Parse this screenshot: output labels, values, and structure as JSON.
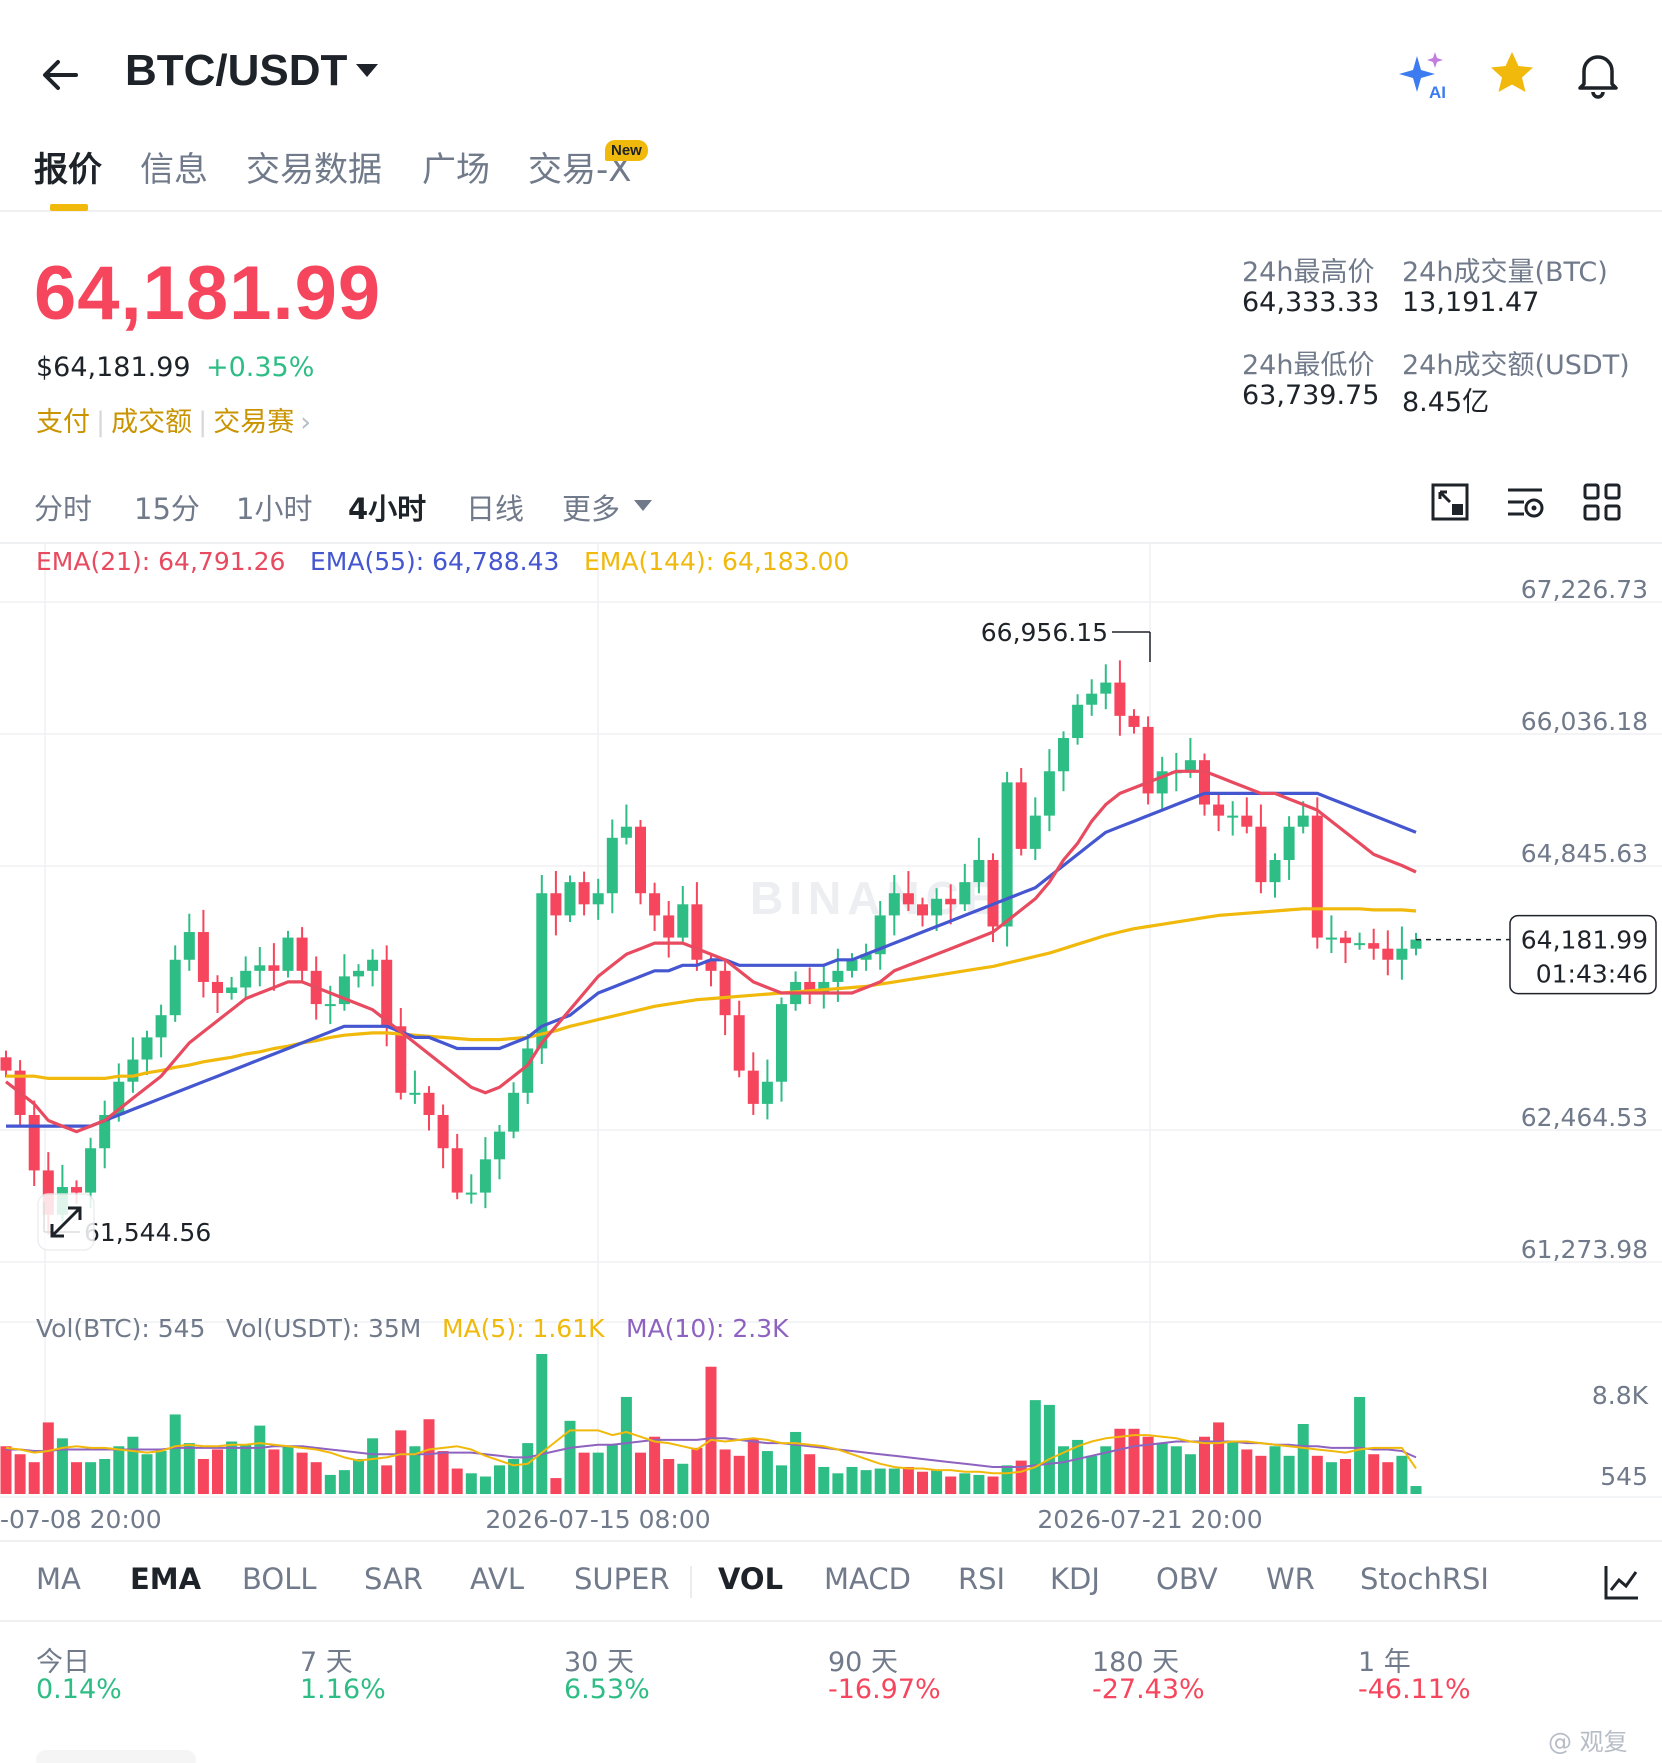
{
  "header": {
    "pair": "BTC/USDT",
    "icons": [
      "back-arrow-icon",
      "ai-sparkle-icon",
      "star-icon",
      "bell-icon"
    ],
    "ai_label": "AI"
  },
  "tabs": [
    {
      "label": "报价",
      "active": true
    },
    {
      "label": "信息",
      "active": false
    },
    {
      "label": "交易数据",
      "active": false
    },
    {
      "label": "广场",
      "active": false
    },
    {
      "label": "交易-X",
      "active": false
    }
  ],
  "new_badge": "New",
  "price": {
    "last": "64,181.99",
    "usd": "$64,181.99",
    "change": "+0.35%"
  },
  "links": [
    "支付",
    "成交额",
    "交易赛"
  ],
  "stats": {
    "high_label": "24h最高价",
    "high": "64,333.33",
    "low_label": "24h最低价",
    "low": "63,739.75",
    "vol_btc_label": "24h成交量(BTC)",
    "vol_btc": "13,191.47",
    "vol_usdt_label": "24h成交额(USDT)",
    "vol_usdt": "8.45亿"
  },
  "intervals": [
    {
      "label": "分时",
      "active": false
    },
    {
      "label": "15分",
      "active": false
    },
    {
      "label": "1小时",
      "active": false
    },
    {
      "label": "4小时",
      "active": true
    },
    {
      "label": "日线",
      "active": false
    },
    {
      "label": "更多",
      "active": false
    }
  ],
  "colors": {
    "up": "#2ebd85",
    "down": "#f6465d",
    "ema21": "#e84a5f",
    "ema55": "#4456d0",
    "ema144": "#f0b90b",
    "ma5": "#f0b90b",
    "ma10": "#8e63c0",
    "accent": "#f0b90b"
  },
  "chart_data": {
    "type": "candlestick",
    "ema_legend": [
      {
        "label": "EMA(21): 64,791.26",
        "color": "#e84a5f"
      },
      {
        "label": "EMA(55): 64,788.43",
        "color": "#4456d0"
      },
      {
        "label": "EMA(144): 64,183.00",
        "color": "#f0b90b"
      }
    ],
    "y_ticks": [
      "67,226.73",
      "66,036.18",
      "64,845.63",
      "62,464.53",
      "61,273.98"
    ],
    "y_tick_values": [
      67226.73,
      66036.18,
      64845.63,
      62464.53,
      61273.98
    ],
    "price_range": [
      61273.98,
      67226.73
    ],
    "high_marker": "66,956.15",
    "low_marker": "61,544.56",
    "current_price": "64,181.99",
    "countdown": "01:43:46",
    "watermark": "BINANCE",
    "x_labels": [
      "-07-08 20:00",
      "2026-07-15 08:00",
      "2026-07-21 20:00"
    ],
    "closes": [
      63000,
      62600,
      62100,
      61700,
      61950,
      61900,
      62300,
      62600,
      62900,
      63100,
      63300,
      63500,
      64000,
      64250,
      63800,
      63700,
      63750,
      63900,
      63950,
      63900,
      64200,
      63900,
      63600,
      63600,
      63850,
      63900,
      64000,
      63400,
      62800,
      62800,
      62600,
      62300,
      61900,
      61900,
      62200,
      62450,
      62800,
      63200,
      64600,
      64400,
      64700,
      64500,
      64600,
      65100,
      65200,
      64600,
      64400,
      64200,
      64500,
      64000,
      63900,
      63500,
      63000,
      62700,
      62900,
      63600,
      63800,
      63700,
      63800,
      63900,
      64000,
      64050,
      64400,
      64600,
      64500,
      64400,
      64550,
      64500,
      64700,
      64900,
      64300,
      65600,
      65000,
      65300,
      65700,
      66000,
      66300,
      66400,
      66500,
      66200,
      66100,
      65500,
      65700,
      65700,
      65800,
      65400,
      65300,
      65300,
      65200,
      64700,
      64900,
      65200,
      65300,
      64200,
      64200,
      64150,
      64150,
      64100,
      64000,
      64100,
      64181.99
    ],
    "ema21": [
      62900,
      62800,
      62700,
      62550,
      62500,
      62450,
      62500,
      62550,
      62650,
      62750,
      62850,
      62950,
      63100,
      63250,
      63350,
      63450,
      63550,
      63650,
      63700,
      63750,
      63800,
      63800,
      63750,
      63700,
      63650,
      63600,
      63550,
      63450,
      63350,
      63250,
      63150,
      63050,
      62950,
      62850,
      62800,
      62850,
      62950,
      63050,
      63250,
      63400,
      63550,
      63700,
      63850,
      63950,
      64050,
      64100,
      64150,
      64150,
      64150,
      64100,
      64050,
      64000,
      63900,
      63800,
      63750,
      63700,
      63700,
      63700,
      63700,
      63700,
      63700,
      63750,
      63800,
      63900,
      63950,
      64000,
      64050,
      64100,
      64150,
      64200,
      64250,
      64350,
      64450,
      64550,
      64700,
      64900,
      65050,
      65250,
      65400,
      65500,
      65550,
      65600,
      65650,
      65700,
      65700,
      65700,
      65650,
      65600,
      65550,
      65500,
      65500,
      65450,
      65400,
      65350,
      65250,
      65150,
      65050,
      64950,
      64900,
      64850,
      64791.26
    ],
    "ema55": [
      62500,
      62500,
      62500,
      62500,
      62500,
      62500,
      62500,
      62550,
      62600,
      62650,
      62700,
      62750,
      62800,
      62850,
      62900,
      62950,
      63000,
      63050,
      63100,
      63150,
      63200,
      63250,
      63300,
      63350,
      63400,
      63400,
      63400,
      63400,
      63350,
      63300,
      63300,
      63250,
      63200,
      63200,
      63200,
      63200,
      63250,
      63300,
      63400,
      63450,
      63500,
      63600,
      63700,
      63750,
      63800,
      63850,
      63900,
      63900,
      63950,
      63950,
      64000,
      64000,
      63950,
      63950,
      63950,
      63950,
      63950,
      63950,
      63950,
      64000,
      64000,
      64050,
      64100,
      64150,
      64200,
      64250,
      64300,
      64350,
      64400,
      64450,
      64500,
      64550,
      64600,
      64650,
      64750,
      64850,
      64950,
      65050,
      65150,
      65200,
      65250,
      65300,
      65350,
      65400,
      65450,
      65500,
      65500,
      65500,
      65500,
      65500,
      65500,
      65500,
      65500,
      65500,
      65450,
      65400,
      65350,
      65300,
      65250,
      65200,
      65150
    ],
    "ema144": [
      62950,
      62950,
      62950,
      62930,
      62930,
      62930,
      62930,
      62930,
      62950,
      62950,
      62980,
      63000,
      63030,
      63050,
      63080,
      63100,
      63120,
      63150,
      63170,
      63200,
      63220,
      63250,
      63270,
      63300,
      63320,
      63330,
      63340,
      63340,
      63330,
      63320,
      63310,
      63300,
      63290,
      63280,
      63280,
      63280,
      63290,
      63300,
      63330,
      63360,
      63400,
      63430,
      63460,
      63490,
      63520,
      63550,
      63580,
      63600,
      63620,
      63640,
      63650,
      63660,
      63670,
      63680,
      63690,
      63700,
      63710,
      63720,
      63730,
      63740,
      63750,
      63760,
      63780,
      63800,
      63820,
      63840,
      63860,
      63880,
      63900,
      63920,
      63940,
      63970,
      64000,
      64030,
      64060,
      64100,
      64140,
      64180,
      64220,
      64250,
      64280,
      64300,
      64320,
      64340,
      64360,
      64380,
      64400,
      64410,
      64420,
      64430,
      64440,
      64450,
      64460,
      64460,
      64460,
      64460,
      64460,
      64450,
      64450,
      64450,
      64440
    ],
    "volume_legend": [
      {
        "label": "Vol(BTC): 545",
        "color": "#707a8a"
      },
      {
        "label": "Vol(USDT): 35M",
        "color": "#707a8a"
      },
      {
        "label": "MA(5): 1.61K",
        "color": "#f0b90b"
      },
      {
        "label": "MA(10): 2.3K",
        "color": "#8e63c0"
      }
    ],
    "volume_ticks": [
      "8.8K",
      "545"
    ],
    "volume_max": 8800,
    "volumes": [
      3000,
      2500,
      2000,
      4500,
      3500,
      2000,
      2000,
      2200,
      3000,
      3600,
      2500,
      2700,
      5000,
      3200,
      2200,
      2800,
      3300,
      3100,
      4300,
      2800,
      3000,
      2600,
      2000,
      1200,
      1500,
      2200,
      3500,
      1800,
      4000,
      3000,
      4700,
      2700,
      1600,
      1300,
      1100,
      1800,
      2200,
      3200,
      8800,
      1000,
      4600,
      2600,
      2600,
      3100,
      6100,
      2600,
      3600,
      2200,
      1900,
      2900,
      8000,
      2800,
      2400,
      3500,
      2700,
      1800,
      3900,
      2500,
      1700,
      1300,
      1700,
      1500,
      1600,
      1600,
      1700,
      1400,
      1500,
      1100,
      1300,
      1200,
      1100,
      1800,
      2100,
      5900,
      5600,
      3000,
      3400,
      2400,
      3000,
      4100,
      4100,
      3600,
      3200,
      3000,
      2500,
      3600,
      4500,
      3300,
      2800,
      2400,
      3000,
      2400,
      4400,
      2400,
      2000,
      2200,
      6100,
      2500,
      2000,
      2400,
      500
    ],
    "volume_ma5": [
      2900,
      2800,
      2600,
      2700,
      2900,
      3000,
      2900,
      2900,
      2800,
      2700,
      2600,
      2700,
      3000,
      3100,
      3000,
      3000,
      3100,
      3100,
      3200,
      3100,
      3000,
      2900,
      2800,
      2600,
      2300,
      2100,
      2200,
      2300,
      2500,
      2500,
      2800,
      2900,
      3000,
      2800,
      2400,
      2100,
      1800,
      1900,
      2600,
      3300,
      4000,
      4000,
      4000,
      3700,
      3900,
      3600,
      3300,
      3200,
      3000,
      2800,
      3400,
      3300,
      3400,
      3500,
      3400,
      3200,
      3200,
      3100,
      3000,
      2800,
      2500,
      2200,
      1900,
      1700,
      1600,
      1600,
      1500,
      1500,
      1400,
      1400,
      1300,
      1300,
      1400,
      1700,
      2200,
      2600,
      3000,
      3300,
      3500,
      3600,
      3700,
      3700,
      3600,
      3500,
      3300,
      3200,
      3200,
      3300,
      3300,
      3200,
      3100,
      3000,
      2900,
      2800,
      2700,
      2600,
      2800,
      2900,
      2900,
      2900,
      1610
    ],
    "volume_ma10": [
      2800,
      2800,
      2700,
      2700,
      2800,
      2800,
      2800,
      2800,
      2800,
      2800,
      2800,
      2800,
      2900,
      2900,
      2900,
      2900,
      2900,
      2900,
      2900,
      3000,
      3000,
      3000,
      2900,
      2800,
      2700,
      2600,
      2500,
      2500,
      2500,
      2500,
      2500,
      2600,
      2600,
      2600,
      2500,
      2400,
      2300,
      2300,
      2500,
      2700,
      2900,
      3000,
      3100,
      3100,
      3200,
      3300,
      3400,
      3400,
      3400,
      3400,
      3500,
      3500,
      3400,
      3300,
      3200,
      3200,
      3100,
      3000,
      2900,
      2800,
      2700,
      2600,
      2500,
      2400,
      2300,
      2200,
      2100,
      2000,
      1900,
      1800,
      1700,
      1700,
      1700,
      1800,
      1900,
      2000,
      2200,
      2400,
      2600,
      2800,
      3000,
      3100,
      3200,
      3300,
      3300,
      3300,
      3300,
      3300,
      3200,
      3200,
      3100,
      3100,
      3000,
      3000,
      2900,
      2900,
      2900,
      2800,
      2800,
      2700,
      2300
    ]
  },
  "indicators": [
    {
      "label": "MA",
      "active": false
    },
    {
      "label": "EMA",
      "active": true
    },
    {
      "label": "BOLL",
      "active": false
    },
    {
      "label": "SAR",
      "active": false
    },
    {
      "label": "AVL",
      "active": false
    },
    {
      "label": "SUPER",
      "active": false
    },
    {
      "label": "VOL",
      "active": true
    },
    {
      "label": "MACD",
      "active": false
    },
    {
      "label": "RSI",
      "active": false
    },
    {
      "label": "KDJ",
      "active": false
    },
    {
      "label": "OBV",
      "active": false
    },
    {
      "label": "WR",
      "active": false
    },
    {
      "label": "StochRSI",
      "active": false
    }
  ],
  "performance": [
    {
      "label": "今日",
      "value": "0.14%",
      "positive": true
    },
    {
      "label": "7 天",
      "value": "1.16%",
      "positive": true
    },
    {
      "label": "30 天",
      "value": "6.53%",
      "positive": true
    },
    {
      "label": "90 天",
      "value": "-16.97%",
      "positive": false
    },
    {
      "label": "180 天",
      "value": "-27.43%",
      "positive": false
    },
    {
      "label": "1 年",
      "value": "-46.11%",
      "positive": false
    }
  ],
  "footer_watermark": "@ 观复"
}
